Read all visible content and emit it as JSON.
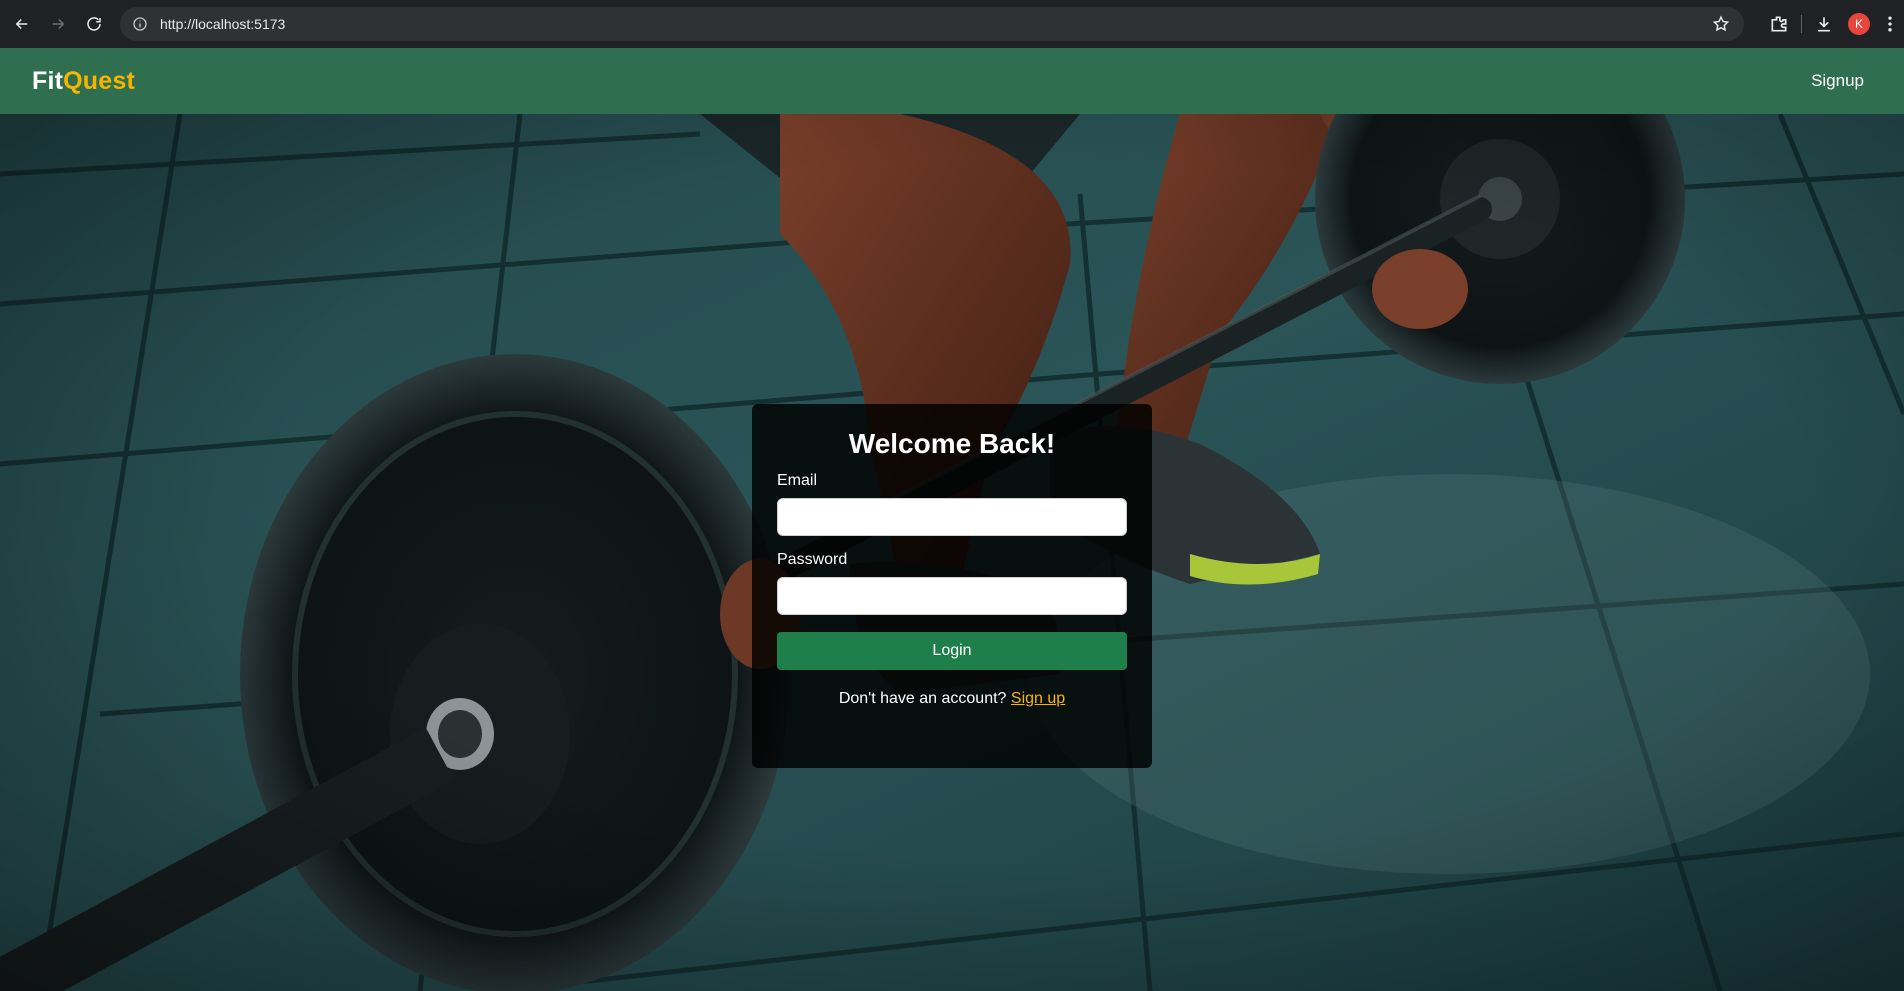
{
  "browser": {
    "url": "http://localhost:5173",
    "profile_initial": "K"
  },
  "navbar": {
    "brand_part1": "Fit",
    "brand_part2": "Quest",
    "signup_link": "Signup"
  },
  "login": {
    "title": "Welcome Back!",
    "email_label": "Email",
    "email_value": "",
    "password_label": "Password",
    "password_value": "",
    "login_button": "Login",
    "signup_prompt": "Don't have an account?",
    "signup_link": "Sign up"
  },
  "colors": {
    "navbar": "#2f6f50",
    "brand_accent": "#f7b500",
    "login_button": "#1f7f4b"
  }
}
